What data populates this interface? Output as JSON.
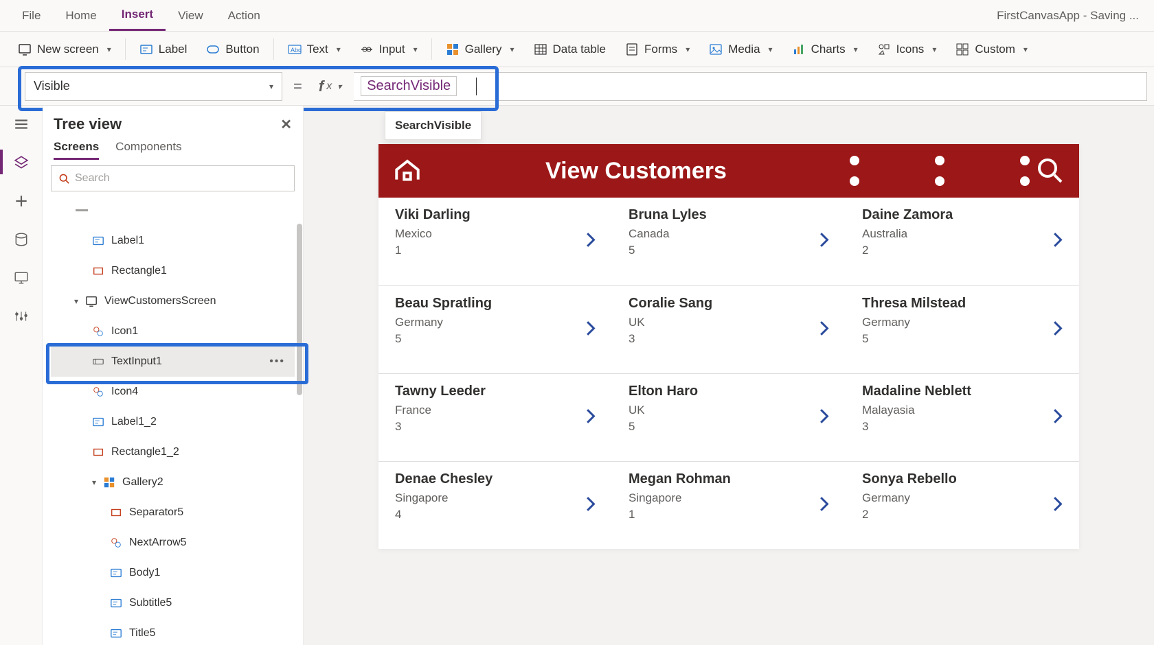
{
  "app_status": "FirstCanvasApp - Saving ...",
  "menu": {
    "file": "File",
    "home": "Home",
    "insert": "Insert",
    "view": "View",
    "action": "Action"
  },
  "ribbon": {
    "newscreen": "New screen",
    "label": "Label",
    "button": "Button",
    "text": "Text",
    "input": "Input",
    "gallery": "Gallery",
    "datatable": "Data table",
    "forms": "Forms",
    "media": "Media",
    "charts": "Charts",
    "icons": "Icons",
    "custom": "Custom"
  },
  "formula": {
    "property": "Visible",
    "expression": "SearchVisible",
    "suggestion": "SearchVisible"
  },
  "treeview": {
    "title": "Tree view",
    "tabs": {
      "screens": "Screens",
      "components": "Components"
    },
    "search_placeholder": "Search",
    "items": {
      "label1": "Label1",
      "rect1": "Rectangle1",
      "screen": "ViewCustomersScreen",
      "icon1": "Icon1",
      "textinput": "TextInput1",
      "icon4": "Icon4",
      "label12": "Label1_2",
      "rect12": "Rectangle1_2",
      "gallery2": "Gallery2",
      "sep5": "Separator5",
      "next5": "NextArrow5",
      "body1": "Body1",
      "subtitle5": "Subtitle5",
      "title5": "Title5"
    }
  },
  "canvas": {
    "header": "View Customers",
    "customers": [
      {
        "name": "Viki  Darling",
        "country": "Mexico",
        "n": "1"
      },
      {
        "name": "Bruna  Lyles",
        "country": "Canada",
        "n": "5"
      },
      {
        "name": "Daine  Zamora",
        "country": "Australia",
        "n": "2"
      },
      {
        "name": "Beau  Spratling",
        "country": "Germany",
        "n": "5"
      },
      {
        "name": "Coralie  Sang",
        "country": "UK",
        "n": "3"
      },
      {
        "name": "Thresa  Milstead",
        "country": "Germany",
        "n": "5"
      },
      {
        "name": "Tawny  Leeder",
        "country": "France",
        "n": "3"
      },
      {
        "name": "Elton  Haro",
        "country": "UK",
        "n": "5"
      },
      {
        "name": "Madaline  Neblett",
        "country": "Malayasia",
        "n": "3"
      },
      {
        "name": "Denae  Chesley",
        "country": "Singapore",
        "n": "4"
      },
      {
        "name": "Megan  Rohman",
        "country": "Singapore",
        "n": "1"
      },
      {
        "name": "Sonya  Rebello",
        "country": "Germany",
        "n": "2"
      }
    ]
  }
}
